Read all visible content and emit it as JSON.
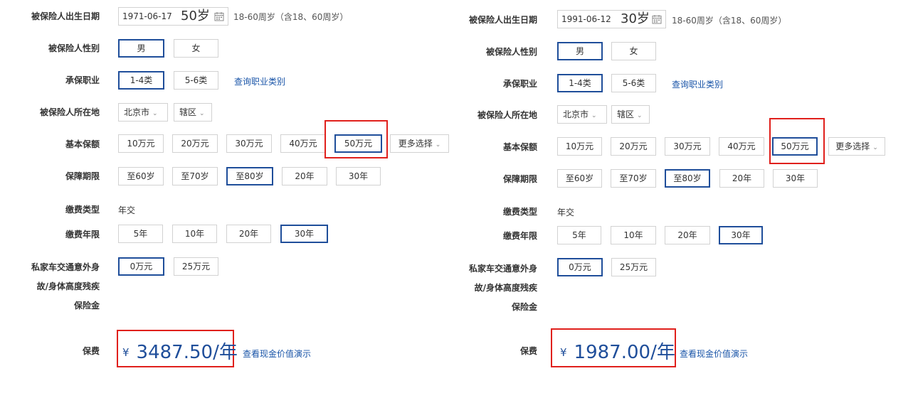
{
  "labels": {
    "birth_date": "被保险人出生日期",
    "gender": "被保险人性别",
    "occupation": "承保职业",
    "location": "被保险人所在地",
    "coverage": "基本保额",
    "period": "保障期限",
    "payment_type": "缴费类型",
    "payment_years": "缴费年限",
    "car_accident_1": "私家车交通意外身",
    "car_accident_2": "故/身体高度残疾",
    "car_accident_3": "保险金",
    "premium": "保费"
  },
  "age_hint": "18-60周岁（含18、60周岁）",
  "gender_options": [
    "男",
    "女"
  ],
  "occupation_options": [
    "1-4类",
    "5-6类"
  ],
  "occupation_link": "查询职业类别",
  "location": {
    "city": "北京市",
    "district": "辖区"
  },
  "coverage_options": [
    "10万元",
    "20万元",
    "30万元",
    "40万元",
    "50万元"
  ],
  "coverage_more": "更多选择",
  "period_options": [
    "至60岁",
    "至70岁",
    "至80岁",
    "20年",
    "30年"
  ],
  "payment_type_value": "年交",
  "payment_years_options": [
    "5年",
    "10年",
    "20年",
    "30年"
  ],
  "car_options": [
    "0万元",
    "25万元"
  ],
  "premium_currency": "¥",
  "cash_value_link": "查看现金价值演示",
  "left": {
    "birth_date": "1971-06-17",
    "age": "50岁",
    "premium": "3487.50/年"
  },
  "right": {
    "birth_date": "1991-06-12",
    "age": "30岁",
    "premium": "1987.00/年"
  },
  "colors": {
    "selected_border": "#1f4e9a",
    "highlight_box": "#e0201c",
    "link": "#1a55a8"
  }
}
